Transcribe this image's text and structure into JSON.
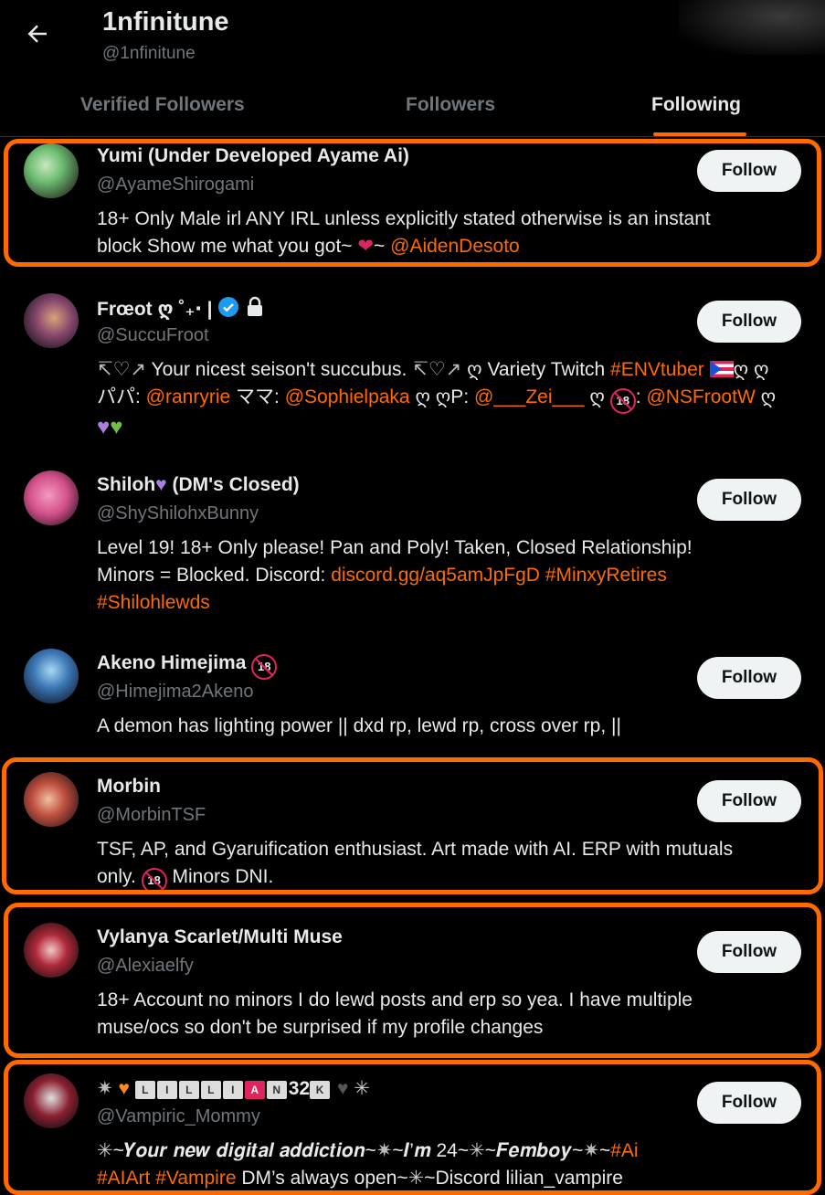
{
  "header": {
    "title": "1nfinitune",
    "handle": "@1nfinitune",
    "back_icon": "arrow-left-icon"
  },
  "tabs": [
    {
      "label": "Verified Followers",
      "active": false
    },
    {
      "label": "Followers",
      "active": false
    },
    {
      "label": "Following",
      "active": true
    }
  ],
  "colors": {
    "accent": "#ff6a00",
    "background": "#000000",
    "follow_button": "#eff3f4",
    "muted_text": "#71767b"
  },
  "users": [
    {
      "name": "Yumi (Under Developed Ayame Ai)",
      "handle": "@AyameShirogami",
      "bio_line1": "18+ Only Male irl ANY IRL unless explicitly stated otherwise is an instant",
      "bio_line2_text": "block Show me what you got~ ",
      "bio_line2_mid": "~ ",
      "bio_line2_link": "@AidenDesoto",
      "follow_label": "Follow",
      "highlighted": true
    },
    {
      "name": "Frœot ღ ˚₊‧ |",
      "handle": "@SuccuFroot",
      "bio_p1": "Your nicest seison't succubus. ",
      "bio_p2": " ღ Variety Twitch ",
      "bio_tag1": "#ENVtuber",
      "bio_p3": "ღ ღ",
      "bio_p4": "パパ: ",
      "bio_link1": "@ranryrie",
      "bio_p5": " ママ: ",
      "bio_link2": "@Sophielpaka",
      "bio_p6": " ღ ღP: ",
      "bio_link3": "@___Zei___",
      "bio_p7": " ღ ",
      "bio_p8": ": ",
      "bio_link4": "@NSFrootW",
      "bio_p9": " ღ",
      "follow_label": "Follow",
      "highlighted": false
    },
    {
      "name": "Shiloh",
      "name_suffix": " (DM's Closed)",
      "handle": "@ShyShilohxBunny",
      "bio_line1": "Level 19! 18+ Only please! Pan and Poly! Taken, Closed Relationship!",
      "bio_line2_text": "Minors = Blocked. Discord: ",
      "bio_link1": "discord.gg/aq5amJpFgD",
      "bio_tag1": " #MinxyRetires",
      "bio_tag2": "#Shilohlewds",
      "follow_label": "Follow",
      "highlighted": false
    },
    {
      "name": "Akeno Himejima",
      "handle": "@Himejima2Akeno",
      "bio_line1": "A demon has lighting power || dxd rp, lewd rp, cross over rp, ||",
      "follow_label": "Follow",
      "highlighted": false
    },
    {
      "name": "Morbin",
      "handle": "@MorbinTSF",
      "bio_line1": "TSF, AP, and Gyaruification enthusiast. Art made with AI. ERP with mutuals",
      "bio_line2_pre": "only. ",
      "bio_line2_post": " Minors DNI.",
      "follow_label": "Follow",
      "highlighted": true
    },
    {
      "name": "Vylanya Scarlet/Multi Muse",
      "handle": "@Alexiaelfy",
      "bio_line1": "18+ Account no minors I do lewd posts and erp so yea. I have multiple",
      "bio_line2": "muse/ocs so don't be surprised if my profile changes",
      "follow_label": "Follow",
      "highlighted": true
    },
    {
      "name_keycaps": [
        "L",
        "I",
        "L",
        "L",
        "I",
        "A",
        "N"
      ],
      "name_count": "32",
      "name_count_cap": "K",
      "handle": "@Vampiric_Mommy",
      "bio_p1": "~𝒀𝒐𝒖𝒓 𝒏𝒆𝒘 𝒅𝒊𝒈𝒊𝒕𝒂𝒍 𝒂𝒅𝒅𝒊𝒄𝒕𝒊𝒐𝒏~",
      "bio_p2": "~𝑰’𝒎 24~",
      "bio_p3": "~𝑭𝒆𝒎𝒃𝒐𝒚~",
      "bio_p4": "~",
      "bio_tag1": "#Ai",
      "bio_tag2": "#AIArt",
      "bio_tag3": " #Vampire",
      "bio_p5": " DM’s always open~",
      "bio_p6": "~Discord lilian_vampire",
      "follow_label": "Follow",
      "highlighted": true
    }
  ],
  "rating_badge": "18"
}
